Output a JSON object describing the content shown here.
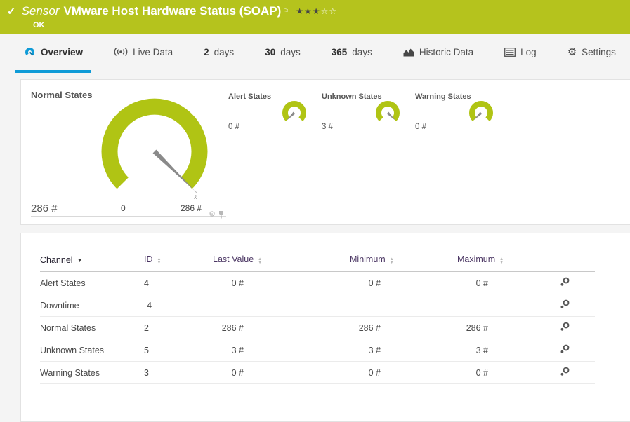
{
  "sensor_header": {
    "kind": "Sensor",
    "title": "VMware Host Hardware Status (SOAP)",
    "status": "OK",
    "rating_filled": "★★★",
    "rating_empty": "☆☆"
  },
  "tabs": [
    {
      "label": "Overview"
    },
    {
      "label": "Live Data"
    },
    {
      "num": "2",
      "label": "days"
    },
    {
      "num": "30",
      "label": "days"
    },
    {
      "num": "365",
      "label": "days"
    },
    {
      "label": "Historic Data"
    },
    {
      "label": "Log"
    },
    {
      "label": "Settings"
    }
  ],
  "gauges": {
    "primary": {
      "title": "Normal States",
      "value": "286 #",
      "scale_min": "0",
      "scale_max": "286 #",
      "marker": "x̄"
    },
    "secondary": [
      {
        "title": "Alert States",
        "value": "0 #"
      },
      {
        "title": "Unknown States",
        "value": "3 #"
      },
      {
        "title": "Warning States",
        "value": "0 #"
      }
    ]
  },
  "channel_table": {
    "columns": [
      "Channel",
      "ID",
      "Last Value",
      "Minimum",
      "Maximum"
    ],
    "rows": [
      {
        "channel": "Alert States",
        "id": "4",
        "last_value": "0 #",
        "minimum": "0 #",
        "maximum": "0 #"
      },
      {
        "channel": "Downtime",
        "id": "-4",
        "last_value": "",
        "minimum": "",
        "maximum": ""
      },
      {
        "channel": "Normal States",
        "id": "2",
        "last_value": "286 #",
        "minimum": "286 #",
        "maximum": "286 #"
      },
      {
        "channel": "Unknown States",
        "id": "5",
        "last_value": "3 #",
        "minimum": "3 #",
        "maximum": "3 #"
      },
      {
        "channel": "Warning States",
        "id": "3",
        "last_value": "0 #",
        "minimum": "0 #",
        "maximum": "0 #"
      }
    ]
  },
  "colors": {
    "brand_green": "#b5c31d",
    "gauge_green": "#b0c414",
    "accent_blue": "#0f9bd7"
  }
}
